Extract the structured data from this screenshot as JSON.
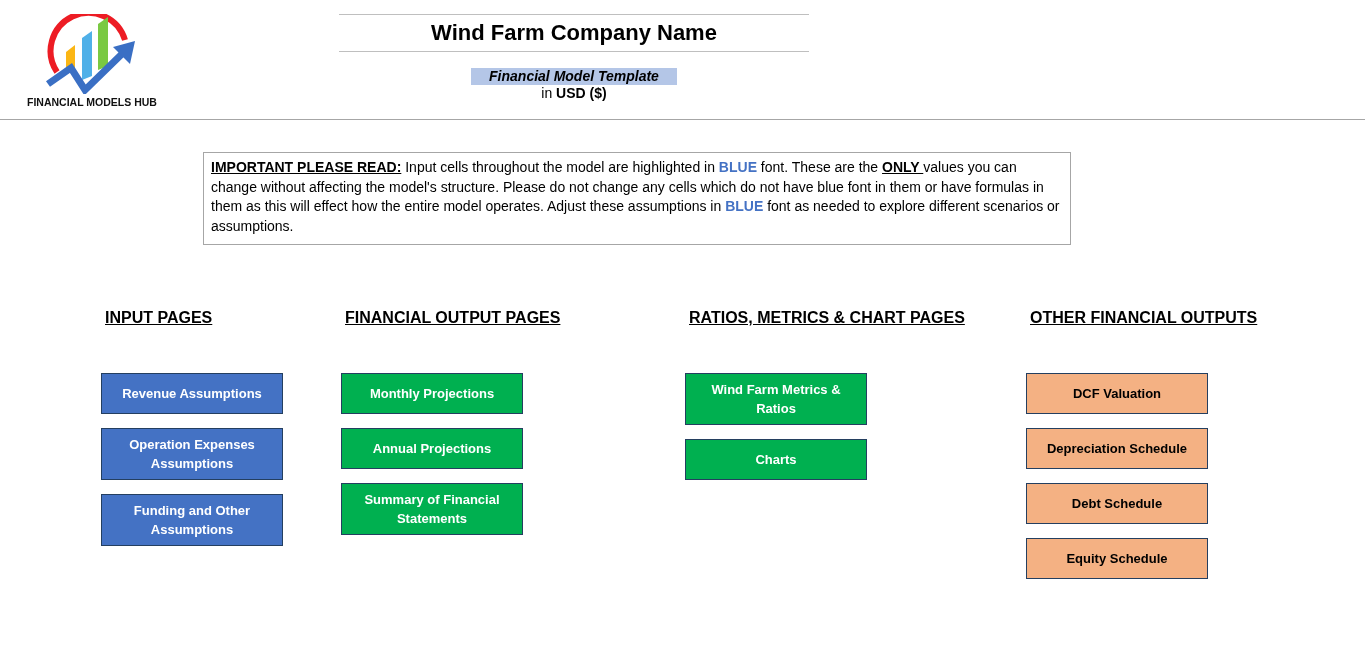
{
  "logo": {
    "text": "FINANCIAL MODELS HUB"
  },
  "header": {
    "title": "Wind Farm Company Name",
    "subtitle": "Financial Model Template",
    "currency": "in **USD ($)**"
  },
  "notice": {
    "segments": [
      {
        "kind": "underlined",
        "text": "IMPORTANT PLEASE READ:"
      },
      {
        "kind": "plain",
        "text": " Input cells throughout the model are highlighted in "
      },
      {
        "kind": "highlight",
        "text": "BLUE"
      },
      {
        "kind": "plain",
        "text": " font. These are the "
      },
      {
        "kind": "underlined",
        "text": "ONLY "
      },
      {
        "kind": "plain",
        "text": "values you can change without affecting the model's structure. Please do not change any cells which do not have blue font in them or have formulas in them as this will effect how the entire model operates. Adjust these assumptions in "
      },
      {
        "kind": "highlight",
        "text": "BLUE"
      },
      {
        "kind": "plain",
        "text": " font as needed to explore different scenarios or assumptions."
      }
    ]
  },
  "sections": [
    {
      "title": "INPUT PAGES",
      "color": "#4472c4",
      "links": [
        "Revenue Assumptions",
        "Operation Expenses Assumptions",
        "Funding and Other Assumptions"
      ]
    },
    {
      "title": "FINANCIAL OUTPUT PAGES",
      "color": "#00b050",
      "links": [
        "Monthly Projections",
        "Annual Projections",
        "Summary of Financial Statements"
      ]
    },
    {
      "title": "RATIOS, METRICS & CHART PAGES",
      "color": "#00b050",
      "links": [
        "Wind Farm Metrics & Ratios",
        "Charts"
      ]
    },
    {
      "title": "OTHER FINANCIAL OUTPUTS",
      "color": "#f4b183",
      "links": [
        "DCF Valuation",
        "Depreciation Schedule",
        "Debt Schedule",
        "Equity Schedule"
      ]
    }
  ]
}
